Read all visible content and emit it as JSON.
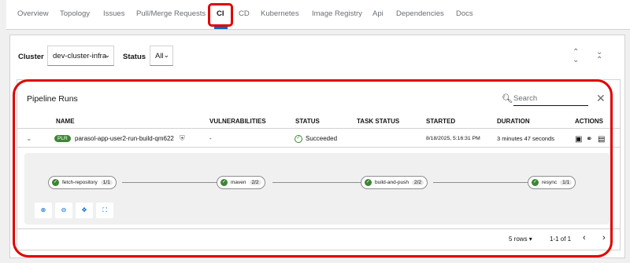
{
  "tabs": [
    {
      "label": "Overview"
    },
    {
      "label": "Topology"
    },
    {
      "label": "Issues"
    },
    {
      "label": "Pull/Merge Requests"
    },
    {
      "label": "CI",
      "active": true
    },
    {
      "label": "CD"
    },
    {
      "label": "Kubernetes"
    },
    {
      "label": "Image Registry"
    },
    {
      "label": "Api"
    },
    {
      "label": "Dependencies"
    },
    {
      "label": "Docs"
    }
  ],
  "filters": {
    "cluster_label": "Cluster",
    "cluster_value": "dev-cluster-infra",
    "status_label": "Status",
    "status_value": "All"
  },
  "pipeline_runs": {
    "title": "Pipeline Runs",
    "search_placeholder": "Search",
    "columns": [
      "NAME",
      "VULNERABILITIES",
      "STATUS",
      "TASK STATUS",
      "STARTED",
      "DURATION",
      "ACTIONS"
    ],
    "row": {
      "badge": "PLR",
      "name": "parasol-app-user2-run-build-qm622",
      "vulnerabilities": "-",
      "status": "Succeeded",
      "started": "8/18/2025, 5:16:31 PM",
      "duration": "3 minutes 47 seconds"
    },
    "tasks": [
      {
        "label": "fetch-repository",
        "count": "1/1"
      },
      {
        "label": "maven",
        "count": "2/2"
      },
      {
        "label": "build-and-push",
        "count": "2/2"
      },
      {
        "label": "resync",
        "count": "1/1"
      }
    ],
    "pagination": {
      "per_page": "5 rows",
      "range": "1-1 of 1"
    }
  },
  "colors": {
    "success": "#3e8635",
    "highlight": "#e00000",
    "link": "#0066cc"
  }
}
